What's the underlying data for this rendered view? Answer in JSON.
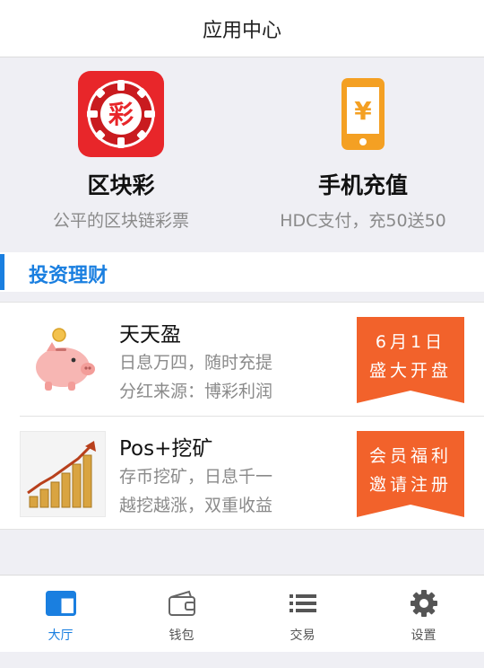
{
  "header": {
    "title": "应用中心"
  },
  "apps": [
    {
      "name": "区块彩",
      "desc": "公平的区块链彩票",
      "icon": "lottery-chip-icon",
      "icon_text": "彩",
      "color": "#e8262a"
    },
    {
      "name": "手机充值",
      "desc": "HDC支付，充50送50",
      "icon": "phone-recharge-icon",
      "icon_text": "¥",
      "color": "#f4a023"
    }
  ],
  "section": {
    "title": "投资理财",
    "accent": "#1a7fe0"
  },
  "products": [
    {
      "title": "天天盈",
      "line1": "日息万四，随时充提",
      "line2": "分红来源：博彩利润",
      "icon": "piggy-bank-icon",
      "badge": [
        "6月1日",
        "盛大开盘"
      ],
      "badge_color": "#f2622b"
    },
    {
      "title": "Pos+挖矿",
      "line1": "存币挖矿，日息千一",
      "line2": "越挖越涨，双重收益",
      "icon": "coin-growth-chart-icon",
      "badge": [
        "会员福利",
        "邀请注册"
      ],
      "badge_color": "#f2622b"
    }
  ],
  "tabs": [
    {
      "label": "大厅",
      "icon": "lobby-icon",
      "active": true
    },
    {
      "label": "钱包",
      "icon": "wallet-icon",
      "active": false
    },
    {
      "label": "交易",
      "icon": "list-icon",
      "active": false
    },
    {
      "label": "设置",
      "icon": "gear-icon",
      "active": false
    }
  ]
}
